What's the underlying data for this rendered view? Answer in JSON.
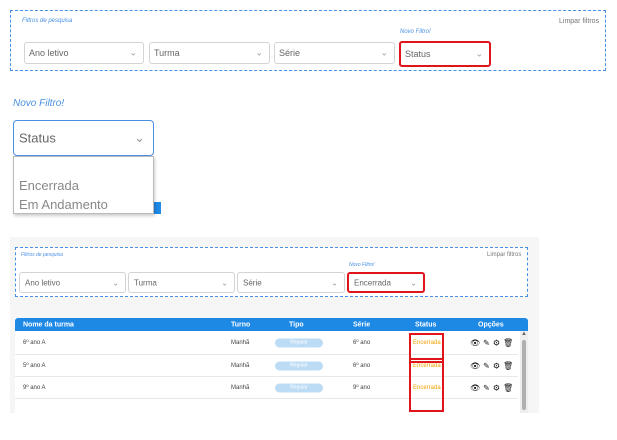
{
  "panel1": {
    "title": "Filtros de pesquisa",
    "clear_label": "Limpar filtros",
    "new_filter_label": "Novo Filtro!",
    "selects": [
      "Ano letivo",
      "Turma",
      "Série",
      "Status"
    ]
  },
  "panel2": {
    "new_filter_label": "Novo Filtro!",
    "select_value": "Status",
    "options": [
      "Encerrada",
      "Em Andamento"
    ]
  },
  "panel3": {
    "title": "Filtros de pesquisa",
    "clear_label": "Limpar filtros",
    "new_filter_label": "Novo Filtro!",
    "selects": [
      "Ano letivo",
      "Turma",
      "Série",
      "Encerrada"
    ]
  },
  "table": {
    "headers": [
      "Nome da turma",
      "Turno",
      "Tipo",
      "Série",
      "Status",
      "Opções"
    ],
    "rows": [
      {
        "name": "6º ano A",
        "turno": "Manhã",
        "tipo": "Regular",
        "serie": "6º ano",
        "status": "Encerrada"
      },
      {
        "name": "5º ano A",
        "turno": "Manhã",
        "tipo": "Regular",
        "serie": "6º ano",
        "status": "Encerrada"
      },
      {
        "name": "9º ano A",
        "turno": "Manhã",
        "tipo": "Regular",
        "serie": "9º ano",
        "status": "Encerrada"
      }
    ]
  },
  "icons": {
    "chevron": "chevron-down-icon",
    "view": "eye-icon",
    "edit": "edit-icon",
    "settings": "gear-icon",
    "delete": "trash-icon"
  },
  "colors": {
    "accent": "#1e88e5",
    "highlight_border": "#e0141b",
    "status_text": "#f2a100",
    "pill": "#bcdcf5"
  }
}
